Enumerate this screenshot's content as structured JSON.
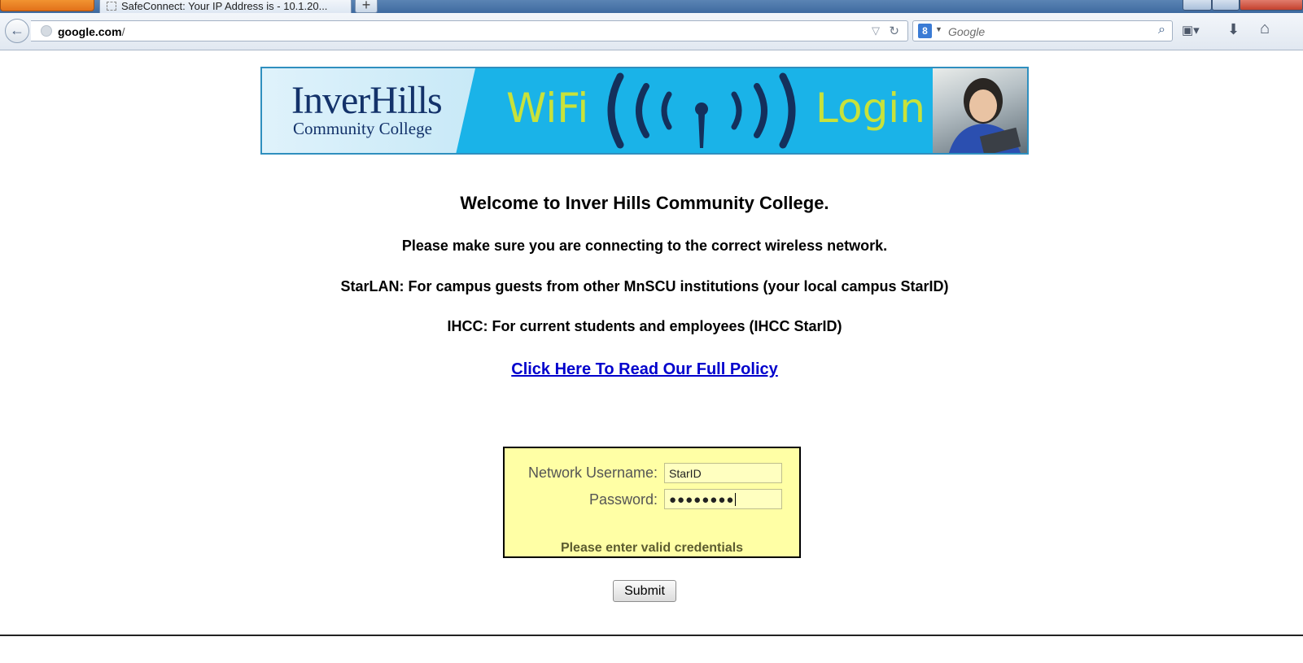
{
  "browser": {
    "tab_title": "SafeConnect: Your IP Address is - 10.1.20...",
    "new_tab_label": "+",
    "url_domain": "google.com",
    "url_rest": "/",
    "search_engine_letter": "8",
    "search_placeholder": "Google"
  },
  "banner": {
    "logo_main": "InverHills",
    "logo_sub": "Community College",
    "wifi_label": "WiFi",
    "login_label": "Login",
    "accent_color": "#c8e23a",
    "background_color": "#1ab3e8"
  },
  "page": {
    "welcome": "Welcome to Inver Hills Community College.",
    "notice": "Please make sure you are connecting to the correct wireless network.",
    "starlan": "StarLAN: For campus guests from other MnSCU institutions (your local campus StarID)",
    "ihcc": "IHCC: For current students and employees (IHCC StarID)",
    "policy_link": "Click Here To Read Our Full Policy"
  },
  "login_form": {
    "username_label": "Network Username:",
    "username_value": "StarID",
    "password_label": "Password:",
    "password_value": "●●●●●●●●",
    "error_message": "Please enter valid credentials",
    "submit_label": "Submit",
    "box_color": "#ffffa5"
  }
}
